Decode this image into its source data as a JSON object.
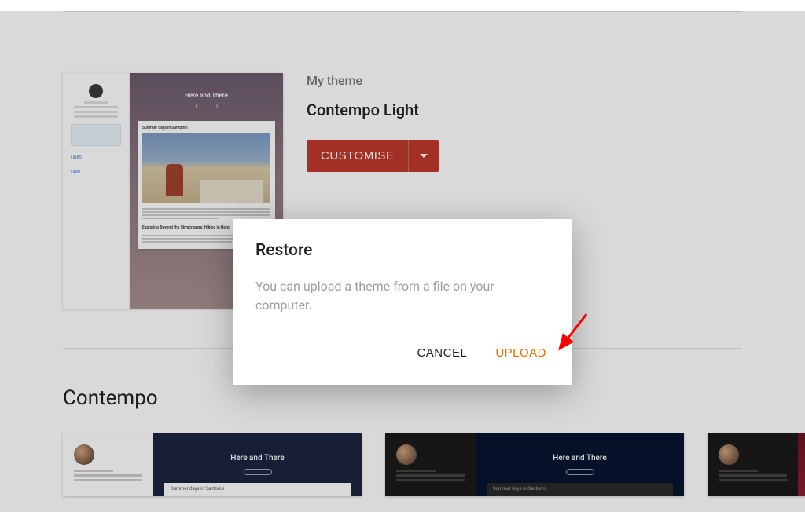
{
  "page": {
    "my_theme_label": "My theme",
    "current_theme_name": "Contempo Light",
    "customise_label": "CUSTOMISE",
    "section_title": "Contempo",
    "thumbnail": {
      "banner_title": "Here and There",
      "post1_title": "Summer days in Santorini",
      "post2_title": "Exploring Beyond the Skyscrapers: Hiking in Hong",
      "sidebar_links": "LINKS",
      "sidebar_label": "Label"
    },
    "grid": {
      "banner_title": "Here and There",
      "card_title": "Summer days in Santorini"
    }
  },
  "dialog": {
    "title": "Restore",
    "body": "You can upload a theme from a file on your computer.",
    "cancel_label": "CANCEL",
    "upload_label": "UPLOAD"
  },
  "colors": {
    "accent": "#c0392b",
    "upload": "#ef6c00"
  }
}
